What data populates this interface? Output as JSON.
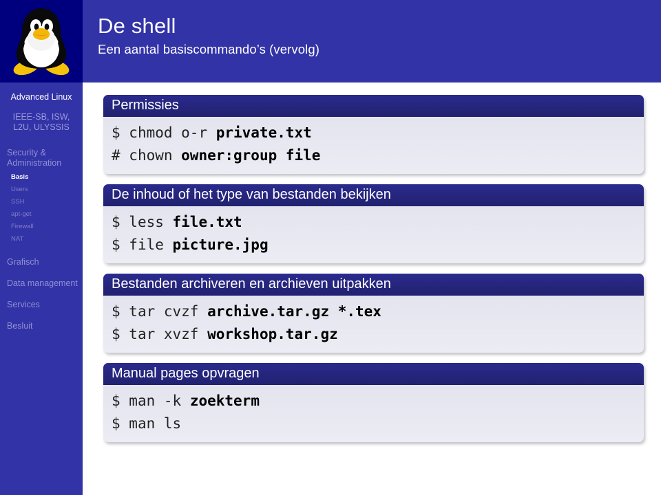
{
  "header": {
    "logo_icon": "tux-penguin-logo",
    "title": "De shell",
    "subtitle": "Een aantal basiscommando’s (vervolg)"
  },
  "sidebar": {
    "presentation_title": "Advanced Linux",
    "author": "IEEE-SB, ISW, L2U, ULYSSIS",
    "sections": [
      {
        "label": "Security & Administration",
        "subsections": [
          {
            "label": "Basis",
            "active": true
          },
          {
            "label": "Users",
            "active": false
          },
          {
            "label": "SSH",
            "active": false
          },
          {
            "label": "apt-get",
            "active": false
          },
          {
            "label": "Firewall",
            "active": false
          },
          {
            "label": "NAT",
            "active": false
          }
        ]
      },
      {
        "label": "Grafisch",
        "subsections": []
      },
      {
        "label": "Data management",
        "subsections": []
      },
      {
        "label": "Services",
        "subsections": []
      },
      {
        "label": "Besluit",
        "subsections": []
      }
    ]
  },
  "blocks": [
    {
      "title": "Permissies",
      "lines": [
        {
          "prompt": "$ ",
          "command": "chmod o-r ",
          "argument": "private.txt"
        },
        {
          "prompt": "# ",
          "command": "chown ",
          "argument": "owner:group file"
        }
      ]
    },
    {
      "title": "De inhoud of het type van bestanden bekijken",
      "lines": [
        {
          "prompt": "$ ",
          "command": "less ",
          "argument": "file.txt"
        },
        {
          "prompt": "$ ",
          "command": "file ",
          "argument": "picture.jpg"
        }
      ]
    },
    {
      "title": "Bestanden archiveren en archieven uitpakken",
      "lines": [
        {
          "prompt": "$ ",
          "command": "tar cvzf ",
          "argument": "archive.tar.gz *.tex"
        },
        {
          "prompt": "$ ",
          "command": "tar xvzf ",
          "argument": "workshop.tar.gz"
        }
      ]
    },
    {
      "title": "Manual pages opvragen",
      "lines": [
        {
          "prompt": "$ ",
          "command": "man -k ",
          "argument": "zoekterm"
        },
        {
          "prompt": "$ ",
          "command": "man ls",
          "argument": ""
        }
      ]
    }
  ],
  "colors": {
    "header_blue": "#3333a8",
    "logo_bg": "#00007e",
    "block_title": "#262686",
    "block_body": "#e7e7f0",
    "sidebar_dim": "#8f8fd2"
  }
}
